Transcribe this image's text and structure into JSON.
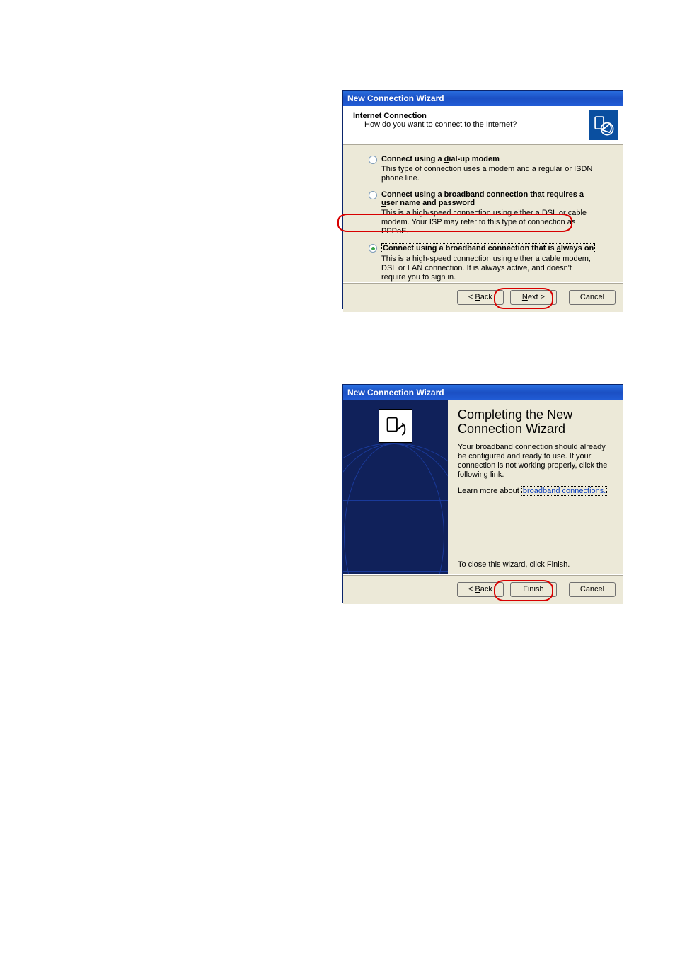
{
  "dialog1": {
    "title": "New Connection Wizard",
    "header_title": "Internet Connection",
    "header_subtitle": "How do you want to connect to the Internet?",
    "options": [
      {
        "label_pre": "Connect using a ",
        "label_ul": "d",
        "label_post": "ial-up modem",
        "desc": "This type of connection uses a modem and a regular or ISDN phone line."
      },
      {
        "label_pre": "Connect using a broadband connection that requires a ",
        "label_ul": "u",
        "label_post": "ser name and password",
        "desc": "This is a high-speed connection using either a DSL or cable modem. Your ISP may refer to this type of connection as PPPoE."
      },
      {
        "label_pre": "Connect using a broadband connection that is ",
        "label_ul": "a",
        "label_post": "lways on",
        "desc": "This is a high-speed connection using either a cable modem, DSL or LAN connection. It is always active, and doesn't require you to sign in."
      }
    ],
    "buttons": {
      "back_pre": "< ",
      "back_ul": "B",
      "back_post": "ack",
      "next_pre": "",
      "next_ul": "N",
      "next_post": "ext >",
      "cancel": "Cancel"
    }
  },
  "dialog2": {
    "title": "New Connection Wizard",
    "heading": "Completing the New Connection Wizard",
    "para1": "Your broadband connection should already be configured and ready to use. If your connection is not working properly, click the following link.",
    "learn_pre": "Learn more about ",
    "learn_link": "broadband connections.",
    "close_line": "To close this wizard, click Finish.",
    "buttons": {
      "back_pre": "< ",
      "back_ul": "B",
      "back_post": "ack",
      "finish": "Finish",
      "cancel": "Cancel"
    }
  }
}
